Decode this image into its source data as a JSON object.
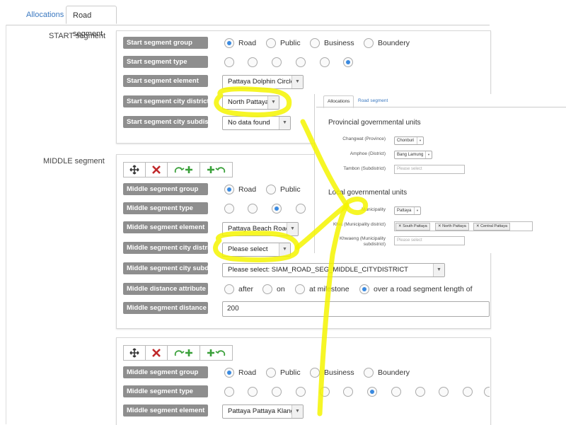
{
  "tabs": [
    {
      "label": "Allocations",
      "active": false
    },
    {
      "label": "Road segment",
      "active": true
    }
  ],
  "start": {
    "section_label": "START segment",
    "group": {
      "label": "Start segment group",
      "options": [
        "Road",
        "Public",
        "Business",
        "Boundery"
      ],
      "selected": 0
    },
    "type": {
      "label": "Start segment type",
      "count": 6,
      "selected": 5
    },
    "element": {
      "label": "Start segment element",
      "value": "Pattaya Dolphin Circle"
    },
    "district": {
      "label": "Start segment city district",
      "value": "North Pattaya"
    },
    "subdistrict": {
      "label": "Start segment city subdistrict",
      "value": "No data found"
    }
  },
  "middle1": {
    "section_label": "MIDDLE segment",
    "group": {
      "label": "Middle segment group",
      "options": [
        "Road",
        "Public"
      ],
      "selected": 0
    },
    "type": {
      "label": "Middle segment type",
      "count": 4,
      "selected": 2
    },
    "element": {
      "label": "Middle segment element",
      "value": "Pattaya Beach Road"
    },
    "district": {
      "label": "Middle segment city district",
      "value": "Please select"
    },
    "subdistrict": {
      "label": "Middle segment city subdistrict",
      "value": "Please select: SIAM_ROAD_SEG_MIDDLE_CITYDISTRICT"
    },
    "distance_attr": {
      "label": "Middle distance attribute",
      "options": [
        "after",
        "on",
        "at milestone",
        "over a road segment length of"
      ],
      "selected": 3
    },
    "distance": {
      "label": "Middle segment distance",
      "value": "200"
    }
  },
  "middle2": {
    "group": {
      "label": "Middle segment group",
      "options": [
        "Road",
        "Public",
        "Business",
        "Boundery"
      ],
      "selected": 0
    },
    "type": {
      "label": "Middle segment type",
      "count": 12,
      "selected": 6
    },
    "element": {
      "label": "Middle segment element",
      "value": "Pattaya Pattaya Klang"
    }
  },
  "overlay": {
    "tabs": [
      "Allocations",
      "Road segment"
    ],
    "provincial_title": "Provincial governmental units",
    "changwat": {
      "label": "Changwat (Province)",
      "value": "Chonburi"
    },
    "amphoe": {
      "label": "Amphoe (District)",
      "value": "Bang Lamung"
    },
    "tambon": {
      "label": "Tambon (Subdistrict)",
      "placeholder": "Please select"
    },
    "local_title": "Local governmental units",
    "municipality": {
      "label": "Municipality",
      "value": "Pattaya"
    },
    "khet": {
      "label": "Khet (Municipality district)",
      "tags": [
        "South Pattaya",
        "North Pattaya",
        "Central Pattaya"
      ]
    },
    "khwaeng": {
      "label_line1": "Khwaeng (Municipality",
      "label_line2": "subdistrict)",
      "placeholder": "Please select"
    }
  },
  "colors": {
    "label_bg": "#8e8e8e",
    "radio_selected": "#3a8ae0",
    "highlight": "#f4f400",
    "link": "#3a78c0",
    "delete": "#c0282a",
    "add": "#3aa03a"
  }
}
